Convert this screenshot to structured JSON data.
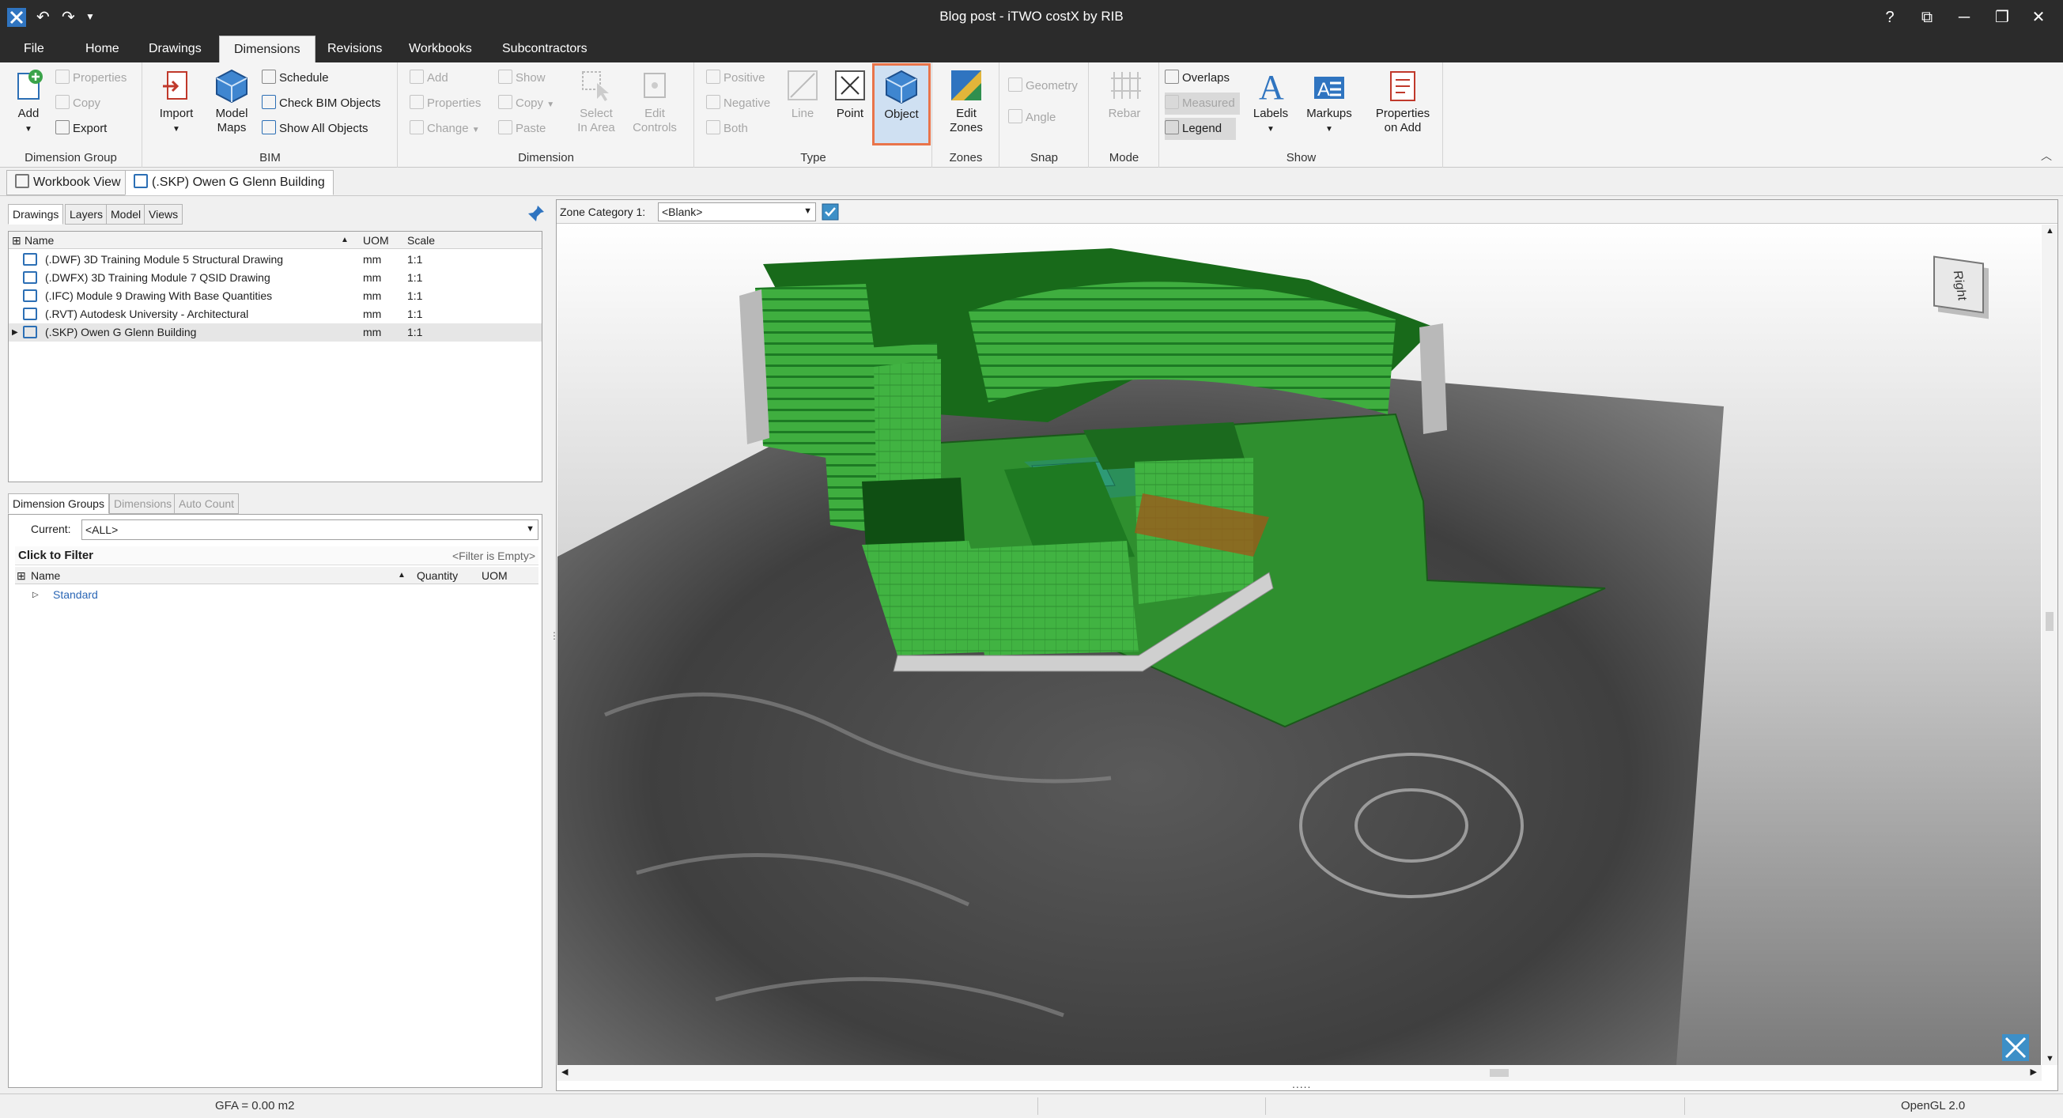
{
  "window": {
    "title": "Blog post - iTWO costX by RIB"
  },
  "titlebar": {
    "app_icon": "costx-logo-icon",
    "qat": [
      "undo-icon",
      "redo-icon",
      "qat-dropdown-icon"
    ],
    "controls": [
      "help-icon",
      "restore-layout-icon",
      "minimize-icon",
      "maximize-icon",
      "close-icon"
    ],
    "help_label": "?"
  },
  "ribbon_tabs": [
    "File",
    "Home",
    "Drawings",
    "Dimensions",
    "Revisions",
    "Workbooks",
    "Subcontractors"
  ],
  "active_ribbon_tab": "Dimensions",
  "ribbon": {
    "dimension_group": {
      "label": "Dimension Group",
      "add": "Add",
      "properties": "Properties",
      "copy": "Copy",
      "export": "Export"
    },
    "bim": {
      "label": "BIM",
      "import": "Import",
      "model_maps": "Model\nMaps",
      "schedule": "Schedule",
      "check_bim_objects": "Check BIM Objects",
      "show_all_objects": "Show All Objects"
    },
    "dimension": {
      "label": "Dimension",
      "add": "Add",
      "properties": "Properties",
      "change": "Change",
      "show": "Show",
      "copy": "Copy",
      "paste": "Paste",
      "select_in_area": "Select\nIn Area",
      "edit_controls": "Edit\nControls"
    },
    "type": {
      "label": "Type",
      "positive": "Positive",
      "negative": "Negative",
      "both": "Both",
      "line": "Line",
      "point": "Point",
      "object": "Object"
    },
    "zones": {
      "label": "Zones",
      "edit_zones": "Edit\nZones"
    },
    "snap": {
      "label": "Snap",
      "geometry": "Geometry",
      "angle": "Angle"
    },
    "mode": {
      "label": "Mode",
      "rebar": "Rebar"
    },
    "show": {
      "label": "Show",
      "overlaps": "Overlaps",
      "measured": "Measured",
      "legend": "Legend",
      "labels": "Labels",
      "markups": "Markups",
      "properties_on_add": "Properties\non Add"
    }
  },
  "doc_tabs": [
    {
      "label": "Workbook View"
    },
    {
      "label": "(.SKP) Owen G Glenn Building"
    }
  ],
  "left_tabs": [
    "Drawings",
    "Layers",
    "Model",
    "Views"
  ],
  "drawings": {
    "columns": [
      "Name",
      "UOM",
      "Scale"
    ],
    "rows": [
      {
        "name": "(.DWF) 3D Training Module 5 Structural Drawing",
        "uom": "mm",
        "scale": "1:1"
      },
      {
        "name": "(.DWFX) 3D Training Module 7 QSID Drawing",
        "uom": "mm",
        "scale": "1:1"
      },
      {
        "name": "(.IFC) Module 9 Drawing With Base Quantities",
        "uom": "mm",
        "scale": "1:1"
      },
      {
        "name": "(.RVT) Autodesk University - Architectural",
        "uom": "mm",
        "scale": "1:1"
      },
      {
        "name": "(.SKP) Owen G Glenn Building",
        "uom": "mm",
        "scale": "1:1"
      }
    ]
  },
  "dim_tabs": [
    "Dimension Groups",
    "Dimensions",
    "Auto Count"
  ],
  "dimension_groups": {
    "current_label": "Current:",
    "current_value": "<ALL>",
    "filter_label": "Click to Filter",
    "filter_status": "<Filter is Empty>",
    "columns": [
      "Name",
      "Quantity",
      "UOM"
    ],
    "rows": [
      {
        "name": "Standard"
      }
    ]
  },
  "viewer": {
    "zone_category_label": "Zone Category 1:",
    "zone_category_value": "<Blank>",
    "viewcube_face": "Right"
  },
  "status": {
    "gfa": "GFA = 0.00 m2",
    "renderer": "OpenGL 2.0",
    "grip": "....."
  },
  "colors": {
    "titlebar": "#2b2b2b",
    "ribbon": "#f4f4f4",
    "model_green": "#38a83a",
    "selected_outline": "#e9744a"
  }
}
